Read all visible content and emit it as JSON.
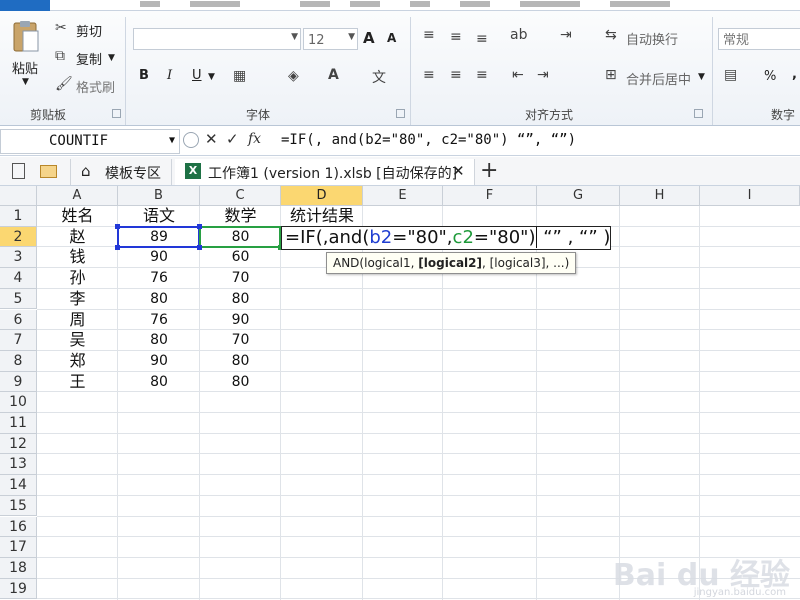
{
  "app": {
    "accent": "#1f6cc2"
  },
  "ribbon": {
    "clipboard": {
      "label": "剪贴板",
      "paste_label": "粘贴",
      "cut_label": "剪切",
      "copy_label": "复制",
      "format_painter_label": "格式刷"
    },
    "font": {
      "label": "字体",
      "font_name": "",
      "font_size": "12",
      "bold": "B",
      "italic": "I",
      "underline": "U",
      "grow": "A",
      "shrink": "A"
    },
    "alignment": {
      "label": "对齐方式",
      "wrap_label": "自动换行",
      "merge_label": "合并后居中"
    },
    "number": {
      "label": "数字",
      "format_value": "常规",
      "percent": "%",
      "comma": ","
    }
  },
  "formula_bar": {
    "name_box": "COUNTIF",
    "cancel": "✕",
    "enter": "✓",
    "fx": "fx",
    "formula": "=IF(, and(b2=\"80\", c2=\"80\") “”, “”)"
  },
  "doc_tabs": {
    "template_tab": "模板专区",
    "workbook_tab": "工作簿1 (version 1).xlsb [自动保存的]",
    "close": "✕",
    "add": "+"
  },
  "grid": {
    "columns": [
      "A",
      "B",
      "C",
      "D",
      "E",
      "F",
      "G",
      "H",
      "I"
    ],
    "rows": [
      "1",
      "2",
      "3",
      "4",
      "5",
      "6",
      "7",
      "8",
      "9",
      "10",
      "11",
      "12",
      "13",
      "14",
      "15",
      "16",
      "17",
      "18",
      "19"
    ],
    "headers": [
      "姓名",
      "语文",
      "数学",
      "统计结果"
    ],
    "data": [
      [
        "赵",
        "89",
        "80"
      ],
      [
        "钱",
        "90",
        "60"
      ],
      [
        "孙",
        "76",
        "70"
      ],
      [
        "李",
        "80",
        "80"
      ],
      [
        "周",
        "76",
        "90"
      ],
      [
        "吴",
        "80",
        "70"
      ],
      [
        "郑",
        "90",
        "80"
      ],
      [
        "王",
        "80",
        "80"
      ]
    ],
    "edit": {
      "p1": "=IF(,and(",
      "p2": "b2",
      "p3": "=\"80\",",
      "p4": "c2",
      "p5": "=\"80\"",
      "p6": ")",
      "p7": " “” , “” )"
    },
    "tooltip": {
      "prefix": "AND(logical1, ",
      "bold": "[logical2]",
      "suffix": ", [logical3], ...)"
    }
  },
  "watermark": {
    "brand": "Bai du 经验",
    "url": "jingyan.baidu.com"
  }
}
